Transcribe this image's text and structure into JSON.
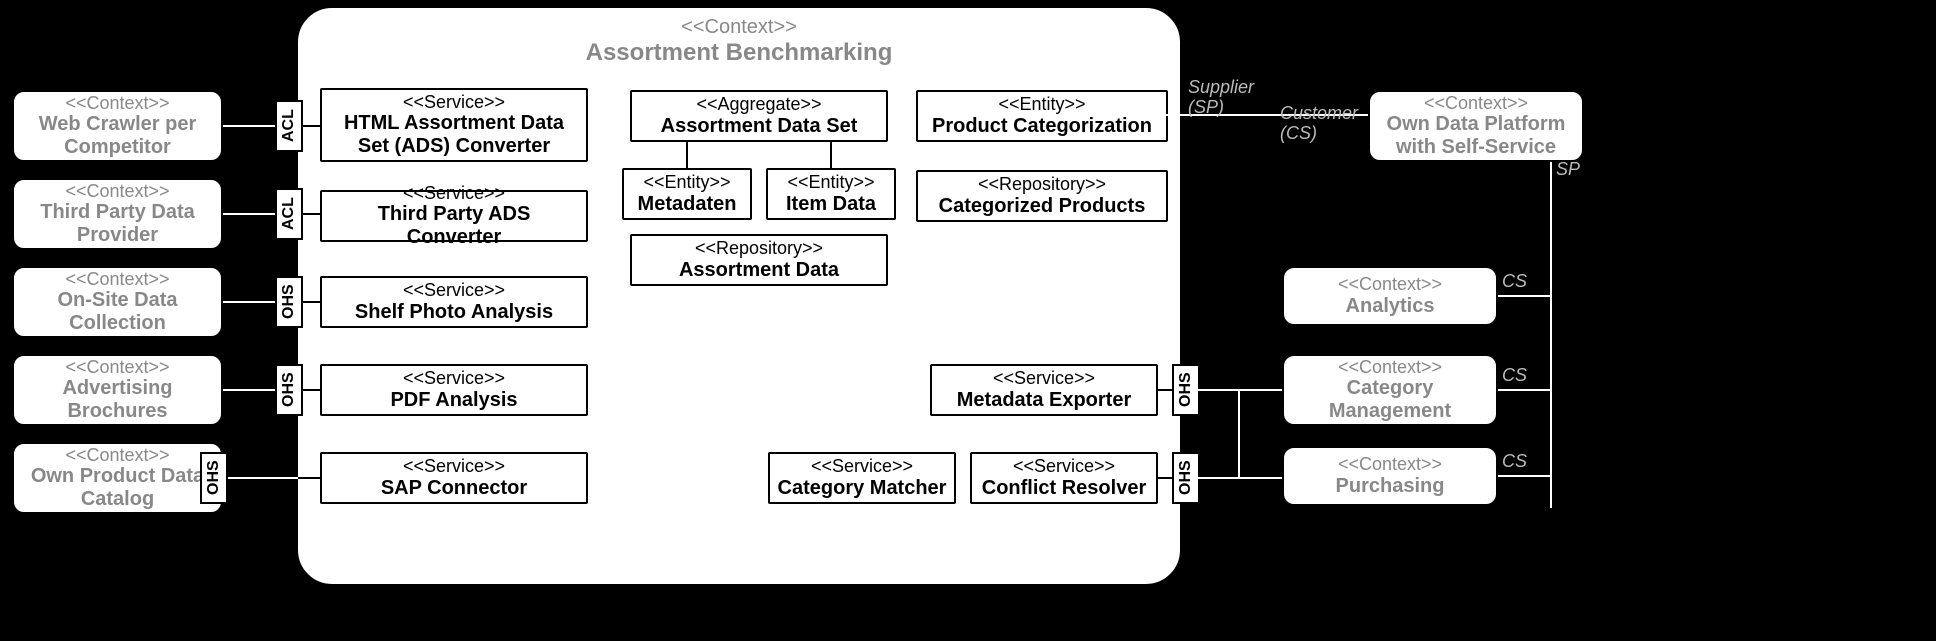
{
  "mainContext": {
    "stereo": "<<Context>>",
    "title": "Assortment Benchmarking"
  },
  "left": [
    {
      "stereo": "<<Context>>",
      "title": "Web Crawler per Competitor"
    },
    {
      "stereo": "<<Context>>",
      "title": "Third Party Data Provider"
    },
    {
      "stereo": "<<Context>>",
      "title": "On-Site Data Collection"
    },
    {
      "stereo": "<<Context>>",
      "title": "Advertising Brochures"
    },
    {
      "stereo": "<<Context>>",
      "title": "Own Product Data Catalog"
    }
  ],
  "leftTags": [
    "ACL",
    "ACL",
    "OHS",
    "OHS",
    "OHS"
  ],
  "services": [
    {
      "stereo": "<<Service>>",
      "title": "HTML Assortment Data Set (ADS) Converter"
    },
    {
      "stereo": "<<Service>>",
      "title": "Third Party ADS Converter"
    },
    {
      "stereo": "<<Service>>",
      "title": "Shelf Photo Analysis"
    },
    {
      "stereo": "<<Service>>",
      "title": "PDF Analysis"
    },
    {
      "stereo": "<<Service>>",
      "title": "SAP Connector"
    }
  ],
  "agg": {
    "stereo": "<<Aggregate>>",
    "title": "Assortment Data Set"
  },
  "entMeta": {
    "stereo": "<<Entity>>",
    "title": "Metadaten"
  },
  "entItem": {
    "stereo": "<<Entity>>",
    "title": "Item Data"
  },
  "repoAD": {
    "stereo": "<<Repository>>",
    "title": "Assortment Data"
  },
  "entPC": {
    "stereo": "<<Entity>>",
    "title": "Product Categorization"
  },
  "repoCP": {
    "stereo": "<<Repository>>",
    "title": "Categorized Products"
  },
  "svcME": {
    "stereo": "<<Service>>",
    "title": "Metadata Exporter"
  },
  "svcCM": {
    "stereo": "<<Service>>",
    "title": "Category Matcher"
  },
  "svcCR": {
    "stereo": "<<Service>>",
    "title": "Conflict Resolver"
  },
  "rightTags": {
    "ohs1": "OHS",
    "ohs2": "OHS"
  },
  "right": {
    "odp": {
      "stereo": "<<Context>>",
      "title": "Own Data Platform with Self-Service"
    },
    "an": {
      "stereo": "<<Context>>",
      "title": "Analytics"
    },
    "cm": {
      "stereo": "<<Context>>",
      "title": "Category Management"
    },
    "pu": {
      "stereo": "<<Context>>",
      "title": "Purchasing"
    }
  },
  "labels": {
    "supplier": "Supplier\n(SP)",
    "customer": "Customer\n(CS)",
    "sp": "SP",
    "cs1": "CS",
    "cs2": "CS",
    "cs3": "CS"
  }
}
